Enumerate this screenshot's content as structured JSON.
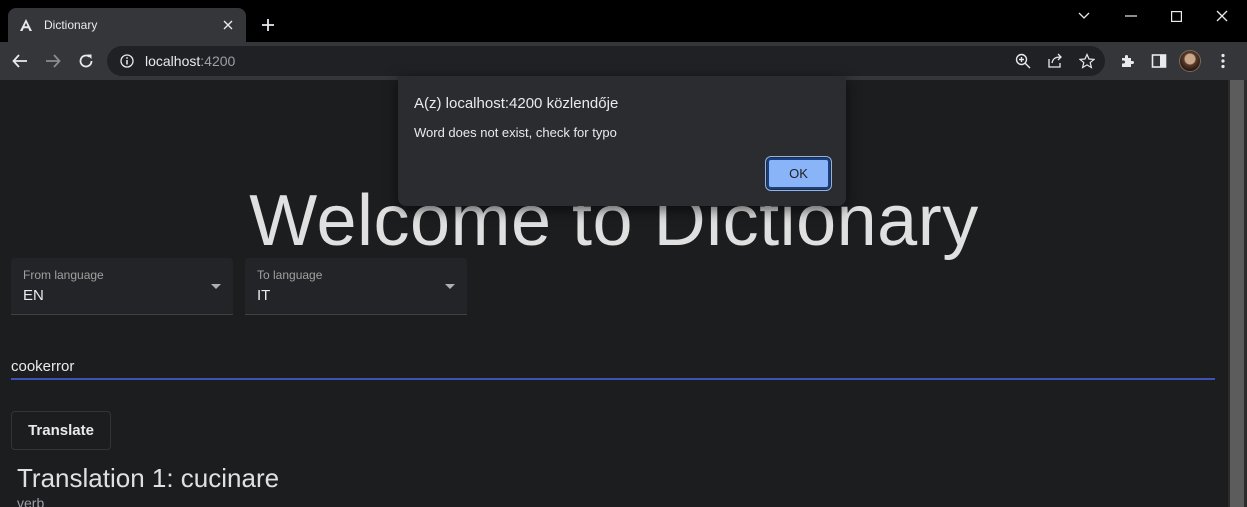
{
  "browser": {
    "tab_title": "Dictionary",
    "url_host": "localhost",
    "url_port": ":4200"
  },
  "page": {
    "headline": "Welcome to Dictionary",
    "from_select": {
      "label": "From language",
      "value": "EN"
    },
    "to_select": {
      "label": "To language",
      "value": "IT"
    },
    "word_input_value": "cookerror",
    "translate_label": "Translate",
    "translation_title": "Translation 1: cucinare",
    "translation_type": "verb"
  },
  "dialog": {
    "title": "A(z) localhost:4200 közlendője",
    "message": "Word does not exist, check for typo",
    "ok_label": "OK"
  },
  "colors": {
    "accent": "#3f51b5",
    "dialog_button": "#8ab4f8",
    "page_background": "#1c1d1f"
  }
}
